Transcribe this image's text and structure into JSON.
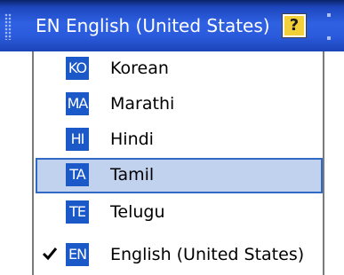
{
  "language_bar": {
    "current_label": "EN English (United States)",
    "help_icon": "help-icon",
    "help_text": "?"
  },
  "language_menu": {
    "items": [
      {
        "code": "KO",
        "label": "Korean",
        "highlighted": false,
        "checked": false
      },
      {
        "code": "MA",
        "label": "Marathi",
        "highlighted": false,
        "checked": false
      },
      {
        "code": "HI",
        "label": "Hindi",
        "highlighted": false,
        "checked": false
      },
      {
        "code": "TA",
        "label": "Tamil",
        "highlighted": true,
        "checked": false
      },
      {
        "code": "TE",
        "label": "Telugu",
        "highlighted": false,
        "checked": false
      },
      {
        "code": "EN",
        "label": "English (United States)",
        "highlighted": false,
        "checked": true
      }
    ],
    "check_icon": "checkmark-icon"
  },
  "colors": {
    "bar_blue": "#2b5bdd",
    "icon_blue": "#1b58c8",
    "highlight_fill": "#c1d2ee",
    "highlight_border": "#316ac5",
    "help_yellow": "#f2d03a"
  }
}
